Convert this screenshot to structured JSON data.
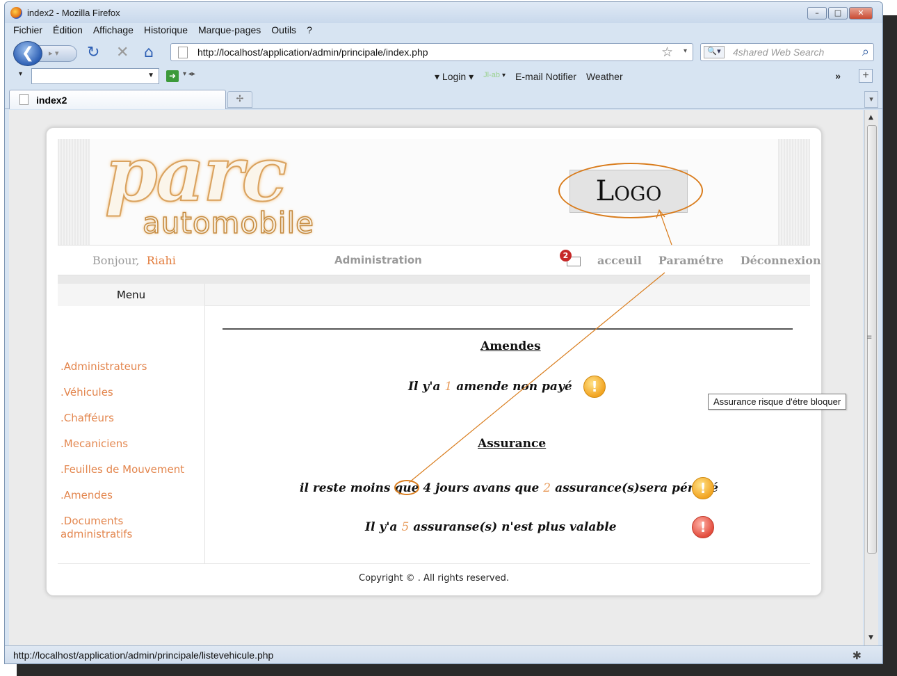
{
  "window": {
    "title": "index2 - Mozilla Firefox"
  },
  "menubar": [
    "Fichier",
    "Édition",
    "Affichage",
    "Historique",
    "Marque-pages",
    "Outils",
    "?"
  ],
  "navbar": {
    "url": "http://localhost/application/admin/principale/index.php",
    "search_placeholder": "4shared Web Search",
    "icons": [
      "back-icon",
      "forward-icon",
      "reload-icon",
      "stop-icon",
      "home-icon",
      "bookmark-star-icon",
      "search-icon"
    ]
  },
  "bookmarks_bar": {
    "login": "Login",
    "jlabel": "Jl-ab",
    "email": "E-mail Notifier",
    "weather": "Weather",
    "more": "»"
  },
  "tabs": [
    {
      "label": "index2"
    }
  ],
  "site": {
    "brand_main": "parc",
    "brand_sub": "automobile",
    "logo_text": "Logo",
    "greeting": "Bonjour,",
    "user": "Riahi",
    "section_title": "Administration",
    "mail_badge": "2",
    "top_nav": [
      "acceuil",
      "Paramétre",
      "Déconnexion"
    ],
    "menu_title": "Menu",
    "sidebar": [
      ".Administrateurs",
      ".Véhicules",
      ".Chafféurs",
      ".Mecaniciens",
      ".Feuilles de Mouvement",
      ".Amendes",
      ".Documents administratifs"
    ],
    "amendes": {
      "title": "Amendes",
      "prefix": "Il y'a",
      "count": "1",
      "suffix": "amende non payé"
    },
    "assurance": {
      "title": "Assurance",
      "line1_prefix": "il reste moins que",
      "days": "4",
      "line1_mid": "jours avans que",
      "count1": "2",
      "line1_suffix": "assurance(s)sera périmé",
      "line2_prefix": "Il y'a",
      "count2": "5",
      "line2_suffix": "assuranse(s) n'est plus valable"
    },
    "tooltip": "Assurance risque d'étre bloquer",
    "footer": "Copyright © . All rights reserved."
  },
  "status": {
    "url": "http://localhost/application/admin/principale/listevehicule.php"
  },
  "colors": {
    "accent_orange": "#e3864e",
    "annotation": "#d97c1c",
    "warn_yellow": "#f2a421",
    "warn_red": "#e34d3e"
  }
}
